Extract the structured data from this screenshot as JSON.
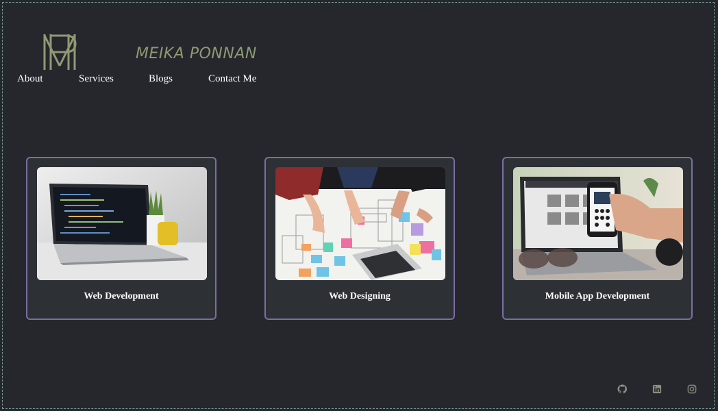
{
  "brand": {
    "name": "MEIKA PONNAN"
  },
  "nav": [
    {
      "label": "About"
    },
    {
      "label": "Services"
    },
    {
      "label": "Blogs"
    },
    {
      "label": "Contact Me"
    }
  ],
  "services": [
    {
      "title": "Web Development",
      "image": "laptop-code-photo"
    },
    {
      "title": "Web Designing",
      "image": "wireframe-sketching-photo"
    },
    {
      "title": "Mobile App Development",
      "image": "mobile-app-photo"
    }
  ],
  "social": [
    {
      "icon": "github-icon"
    },
    {
      "icon": "linkedin-icon"
    },
    {
      "icon": "instagram-icon"
    }
  ],
  "colors": {
    "background": "#26272d",
    "card_border": "#7a6fa3",
    "brand_text": "#8f9a72",
    "nav_text": "#ffffff"
  }
}
